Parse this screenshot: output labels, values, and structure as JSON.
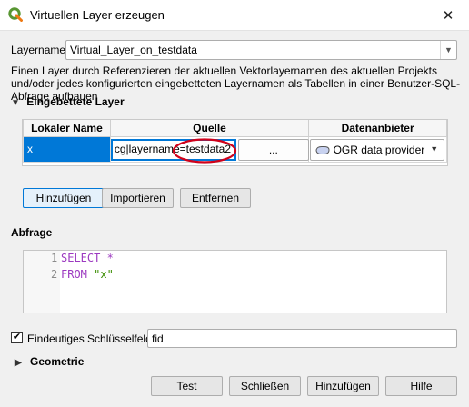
{
  "window": {
    "title": "Virtuellen Layer erzeugen",
    "close_glyph": "✕"
  },
  "layername": {
    "label": "Layername",
    "value": "Virtual_Layer_on_testdata"
  },
  "description": "Einen Layer durch Referenzieren der aktuellen Vektorlayernamen des aktuellen Projekts und/oder jedes konfigurierten eingebetteten Layernamen als Tabellen in einer Benutzer-SQL-Abfrage aufbauen",
  "embedded": {
    "title": "Eingebettete Layer",
    "columns": [
      "Lokaler Name",
      "Quelle",
      "Datenanbieter"
    ],
    "row": {
      "local_name": "x",
      "source": "cg|layername=testdata2",
      "browse": "...",
      "provider": "OGR data provider"
    },
    "buttons": {
      "add": "Hinzufügen",
      "import": "Importieren",
      "remove": "Entfernen"
    }
  },
  "query": {
    "title": "Abfrage",
    "lines": [
      {
        "num": "1",
        "keyword": "SELECT",
        "rest": " *",
        "string": ""
      },
      {
        "num": "2",
        "keyword": "FROM",
        "rest": " ",
        "string": "\"x\""
      }
    ]
  },
  "unique_key": {
    "checked": true,
    "label": "Eindeutiges Schlüsselfeld",
    "value": "fid"
  },
  "geometry": {
    "title": "Geometrie"
  },
  "footer": {
    "test": "Test",
    "close": "Schließen",
    "add": "Hinzufügen",
    "help": "Hilfe"
  },
  "colors": {
    "accent": "#0078d7",
    "annotation_red": "#d0021b",
    "qgis_green": "#589632"
  }
}
